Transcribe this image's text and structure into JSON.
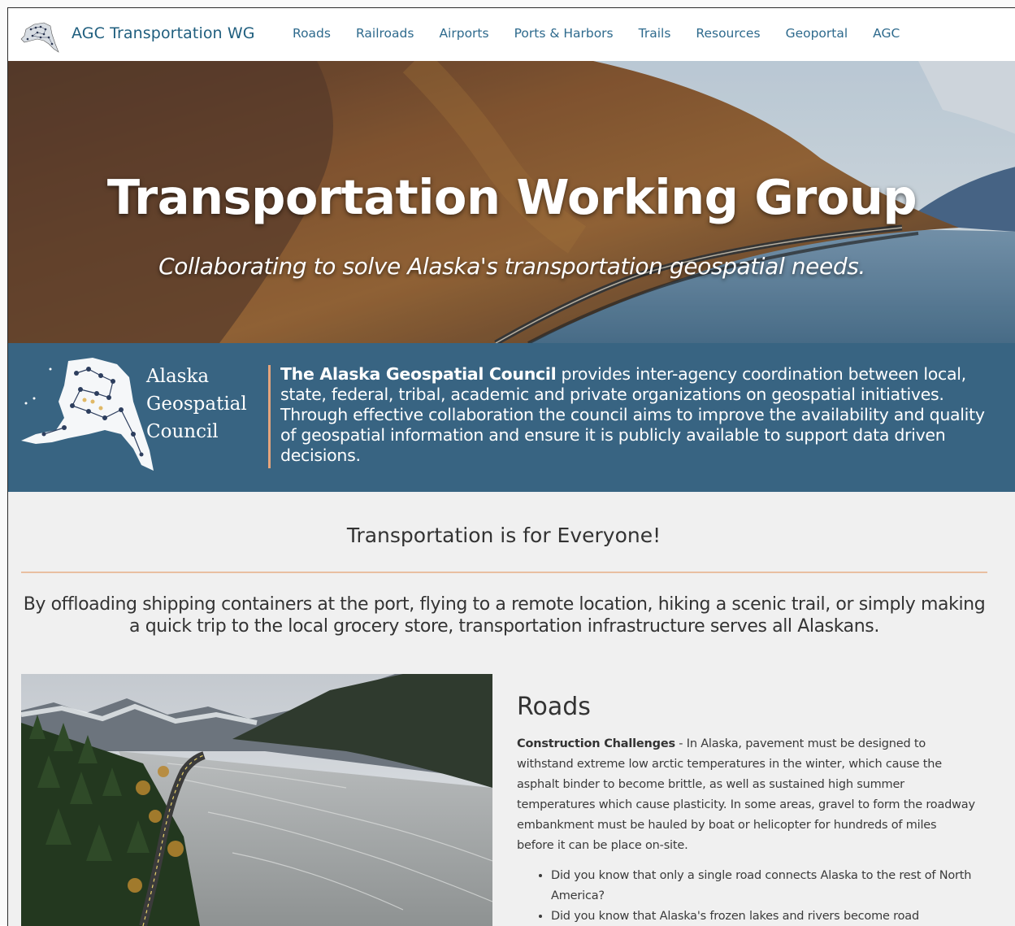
{
  "header": {
    "site_title": "AGC Transportation WG",
    "nav": [
      "Roads",
      "Railroads",
      "Airports",
      "Ports & Harbors",
      "Trails",
      "Resources",
      "Geoportal",
      "AGC"
    ]
  },
  "hero": {
    "title": "Transportation Working Group",
    "subtitle": "Collaborating to solve Alaska's transportation geospatial needs."
  },
  "council": {
    "name_lines": [
      "Alaska",
      "Geospatial",
      "Council"
    ],
    "description_bold": "The Alaska Geospatial Council",
    "description_rest": " provides inter-agency coordination between local, state, federal, tribal, academic and private organizations on geospatial initiatives. Through effective collaboration the council aims to improve the availability and quality of geospatial information and ensure it is publicly available to support data driven decisions."
  },
  "main": {
    "heading": "Transportation is for Everyone!",
    "intro": "By offloading shipping containers at the port, flying to a remote location, hiking a scenic trail, or simply making a quick trip to the local grocery store, transportation infrastructure serves all Alaskans."
  },
  "roads": {
    "title": "Roads",
    "lead": "Construction Challenges",
    "body": "  - In Alaska, pavement must be designed to withstand extreme low arctic temperatures in the winter, which cause the asphalt binder to become brittle, as well as sustained high summer temperatures which cause plasticity. In some areas, gravel to form the roadway embankment must be hauled by boat or helicopter for hundreds of miles before it can be place on-site.",
    "facts": [
      "Did you know that only a single road connects Alaska to the rest of North America?",
      "Did you know that Alaska's frozen lakes and rivers become road"
    ]
  },
  "colors": {
    "brand_blue": "#1f5e7e",
    "council_band": "#386482",
    "accent_rule": "#e9bfa1"
  }
}
